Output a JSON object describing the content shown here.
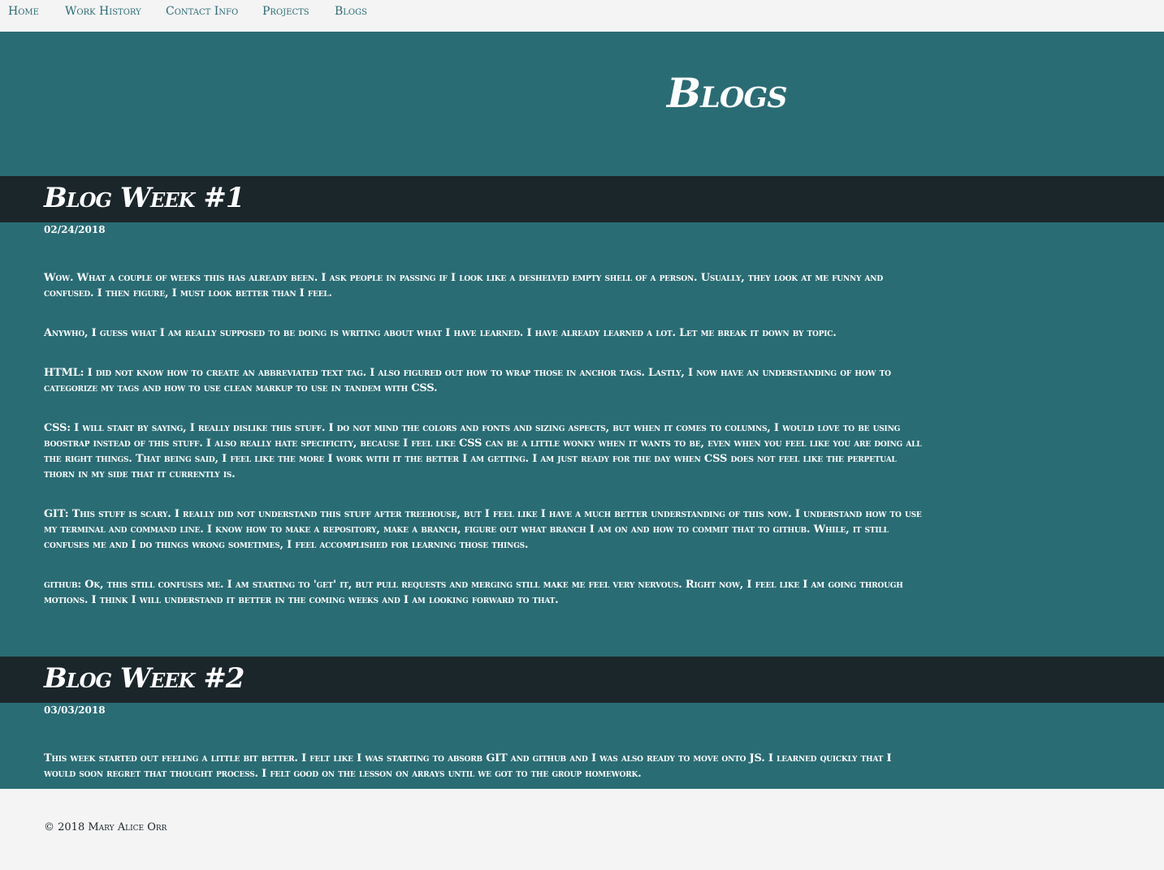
{
  "nav": {
    "items": [
      {
        "label": "Home"
      },
      {
        "label": "Work History"
      },
      {
        "label": "Contact Info"
      },
      {
        "label": "Projects"
      },
      {
        "label": "Blogs"
      }
    ]
  },
  "page": {
    "title": "Blogs"
  },
  "posts": [
    {
      "title": "Blog Week #1",
      "date": "02/24/2018",
      "paragraphs": [
        "Wow. What a couple of weeks this has already been. I ask people in passing if I look like a deshelved empty shell of a person. Usually, they look at me funny and confused. I then figure, I must look better than I feel.",
        "Anywho, I guess what I am really supposed to be doing is writing about what I have learned. I have already learned a lot. Let me break it down by topic.",
        "HTML: I did not know how to create an abbreviated text tag. I also figured out how to wrap those in anchor tags. Lastly, I now have an understanding of how to categorize my tags and how to use clean markup to use in tandem with CSS.",
        "CSS: I will start by saying, I really dislike this stuff. I do not mind the colors and fonts and sizing aspects, but when it comes to columns, I would love to be using boostrap instead of this stuff. I also really hate specificity, because I feel like CSS can be a little wonky when it wants to be, even when you feel like you are doing all the right things. That being said, I feel like the more I work with it the better I am getting. I am just ready for the day when CSS does not feel like the perpetual thorn in my side that it currently is.",
        "GIT: This stuff is scary. I really did not understand this stuff after treehouse, but I feel like I have a much better understanding of this now. I understand how to use my terminal and command line. I know how to make a repository, make a branch, figure out what branch I am on and how to commit that to github. While, it still confuses me and I do things wrong sometimes, I feel accomplished for learning those things.",
        "github: Ok, this still confuses me. I am starting to 'get' it, but pull requests and merging still make me feel very nervous. Right now, I feel like I am going through motions. I think I will understand it better in the coming weeks and I am looking forward to that."
      ]
    },
    {
      "title": "Blog Week #2",
      "date": "03/03/2018",
      "paragraphs": [
        "This week started out feeling a little bit better. I felt like I was starting to absorb GIT and github and I was also ready to move onto JS. I learned quickly that I would soon regret that thought process. I felt good on the lesson on arrays until we got to the group homework."
      ]
    }
  ],
  "footer": {
    "text": "© 2018 Mary Alice Orr"
  },
  "colors": {
    "teal": "#2a6c74",
    "dark": "#1b262b",
    "background": "#f4f4f4",
    "text_light": "#ffffff"
  }
}
